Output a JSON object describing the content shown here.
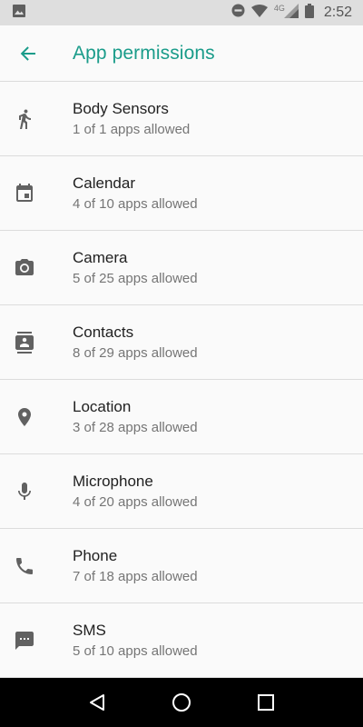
{
  "status_bar": {
    "time": "2:52",
    "network_label": "4G",
    "icons": [
      "image-icon",
      "do-not-disturb-icon",
      "wifi-icon",
      "signal-icon",
      "battery-icon"
    ]
  },
  "app_bar": {
    "title": "App permissions",
    "back_icon": "arrow-back-icon",
    "accent_color": "#1a9c8a"
  },
  "permissions": [
    {
      "name": "Body Sensors",
      "summary": "1 of 1 apps allowed",
      "icon": "body-sensors-icon"
    },
    {
      "name": "Calendar",
      "summary": "4 of 10 apps allowed",
      "icon": "calendar-icon"
    },
    {
      "name": "Camera",
      "summary": "5 of 25 apps allowed",
      "icon": "camera-icon"
    },
    {
      "name": "Contacts",
      "summary": "8 of 29 apps allowed",
      "icon": "contacts-icon"
    },
    {
      "name": "Location",
      "summary": "3 of 28 apps allowed",
      "icon": "location-icon"
    },
    {
      "name": "Microphone",
      "summary": "4 of 20 apps allowed",
      "icon": "microphone-icon"
    },
    {
      "name": "Phone",
      "summary": "7 of 18 apps allowed",
      "icon": "phone-icon"
    },
    {
      "name": "SMS",
      "summary": "5 of 10 apps allowed",
      "icon": "sms-icon"
    }
  ],
  "nav_bar": {
    "icons": [
      "back-triangle-icon",
      "home-circle-icon",
      "recents-square-icon"
    ]
  }
}
